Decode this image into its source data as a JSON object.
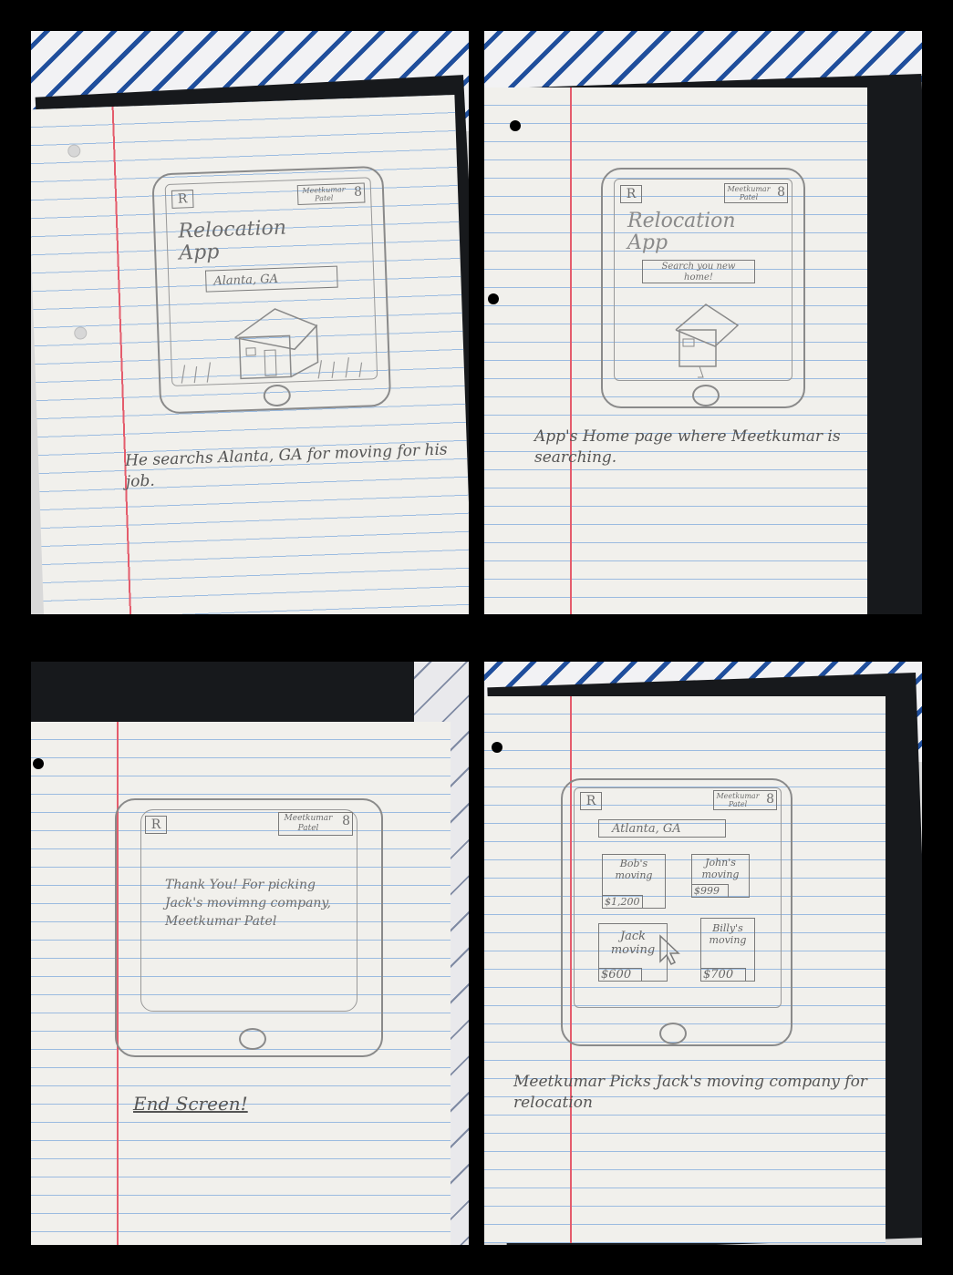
{
  "panels": [
    {
      "logo": "R",
      "user": "Meetkumar Patel",
      "title": "Relocation App",
      "search": "Alanta, GA",
      "caption": "He searchs Alanta, GA for moving for his job."
    },
    {
      "logo": "R",
      "user": "Meetkumar Patel",
      "title": "Relocation App",
      "search": "Search you new home!",
      "caption": "App's Home page where Meetkumar is searching."
    },
    {
      "logo": "R",
      "user": "Meetkumar Patel",
      "message": "Thank You! For picking Jack's movimng company, Meetkumar Patel",
      "caption": "End Screen!"
    },
    {
      "logo": "R",
      "user": "Meetkumar Patel",
      "search": "Atlanta, GA",
      "cards": [
        {
          "name": "Bob's moving",
          "price": "$1,200"
        },
        {
          "name": "John's moving",
          "price": "$999"
        },
        {
          "name": "Jack moving",
          "price": "$600"
        },
        {
          "name": "Billy's moving",
          "price": "$700"
        }
      ],
      "caption": "Meetkumar Picks Jack's moving company for relocation"
    }
  ]
}
